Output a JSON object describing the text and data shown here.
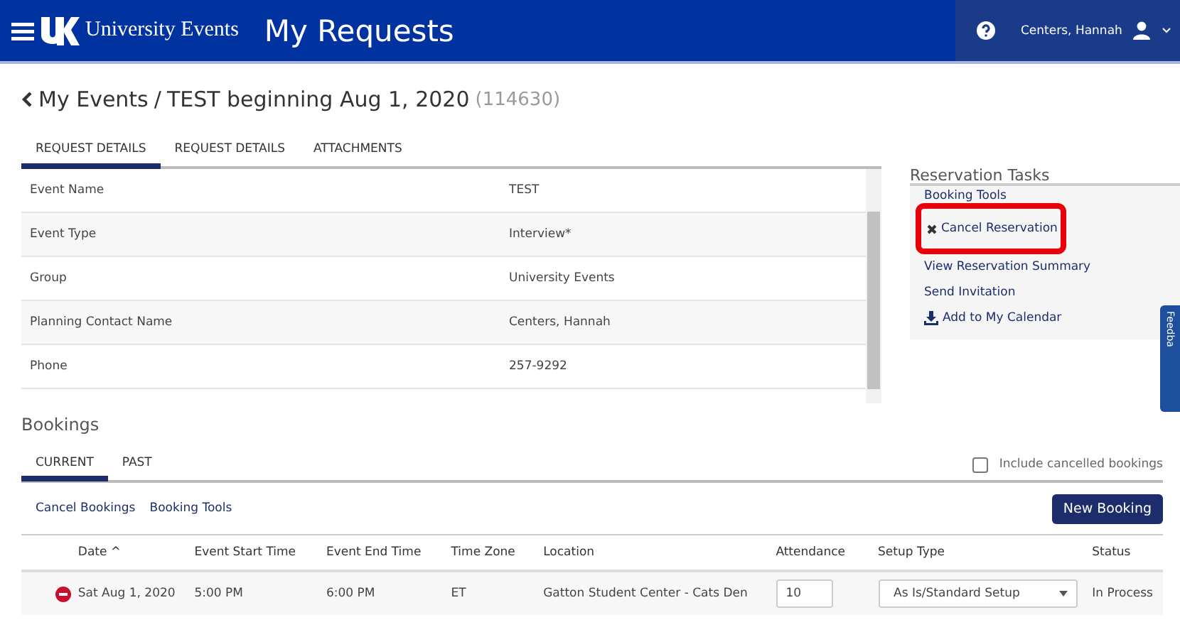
{
  "header": {
    "brand": "University Events",
    "title": "My Requests",
    "user": "Centers, Hannah"
  },
  "breadcrumb": {
    "parent": "My Events",
    "separator": "/",
    "event": "TEST beginning Aug 1, 2020",
    "id": "(114630)"
  },
  "tabs": [
    {
      "label": "REQUEST DETAILS",
      "selected": true
    },
    {
      "label": "REQUEST DETAILS",
      "selected": false
    },
    {
      "label": "ATTACHMENTS",
      "selected": false
    }
  ],
  "details": [
    {
      "label": "Event Name",
      "value": "TEST"
    },
    {
      "label": "Event Type",
      "value": "Interview*"
    },
    {
      "label": "Group",
      "value": "University Events"
    },
    {
      "label": "Planning Contact Name",
      "value": "Centers, Hannah"
    },
    {
      "label": "Phone",
      "value": "257-9292"
    }
  ],
  "tasks": {
    "title": "Reservation Tasks",
    "items": [
      {
        "label": "Booking Tools",
        "kind": "heading"
      },
      {
        "label": "Cancel Reservation",
        "kind": "cancel",
        "highlighted": true
      },
      {
        "label": "View Reservation Summary",
        "kind": "link"
      },
      {
        "label": "Send Invitation",
        "kind": "link"
      },
      {
        "label": "Add to My Calendar",
        "kind": "download"
      }
    ]
  },
  "feedback": "Feedba",
  "bookings": {
    "title": "Bookings",
    "tabs": [
      {
        "label": "CURRENT",
        "selected": true
      },
      {
        "label": "PAST",
        "selected": false
      }
    ],
    "include_cancelled": {
      "label": "Include cancelled bookings",
      "checked": false
    },
    "links": [
      "Cancel Bookings",
      "Booking Tools"
    ],
    "new_button": "New Booking",
    "columns": [
      "",
      "Date ^",
      "Event Start Time",
      "Event End Time",
      "Time Zone",
      "Location",
      "Attendance",
      "Setup Type",
      "Status"
    ],
    "rows": [
      {
        "date": "Sat Aug 1, 2020",
        "start": "5:00 PM",
        "end": "6:00 PM",
        "tz": "ET",
        "location": "Gatton Student Center - Cats Den",
        "attendance": "10",
        "setup": "As Is/Standard Setup",
        "status": "In Process"
      }
    ]
  }
}
